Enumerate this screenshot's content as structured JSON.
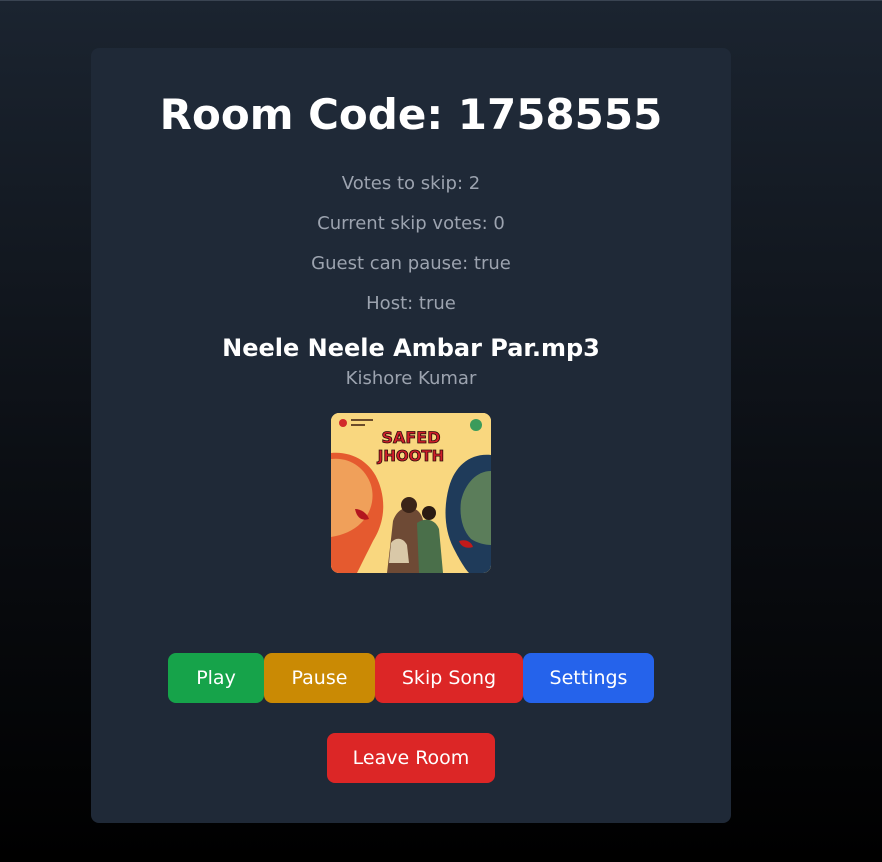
{
  "room": {
    "title": "Room Code: 1758555",
    "votes_to_skip": "Votes to skip: 2",
    "current_skip_votes": "Current skip votes: 0",
    "guest_can_pause": "Guest can pause: true",
    "host": "Host: true"
  },
  "song": {
    "title": "Neele Neele Ambar Par.mp3",
    "artist": "Kishore Kumar",
    "cover_title_line1": "SAFED",
    "cover_title_line2": "JHOOTH"
  },
  "controls": {
    "play_label": "Play",
    "pause_label": "Pause",
    "skip_label": "Skip Song",
    "settings_label": "Settings",
    "leave_label": "Leave Room"
  },
  "colors": {
    "background": "#000000",
    "card": "#1f2937",
    "play": "#16a34a",
    "pause": "#ca8a04",
    "skip": "#dc2626",
    "settings": "#2563eb",
    "leave": "#dc2626",
    "muted_text": "#9ca3af"
  }
}
